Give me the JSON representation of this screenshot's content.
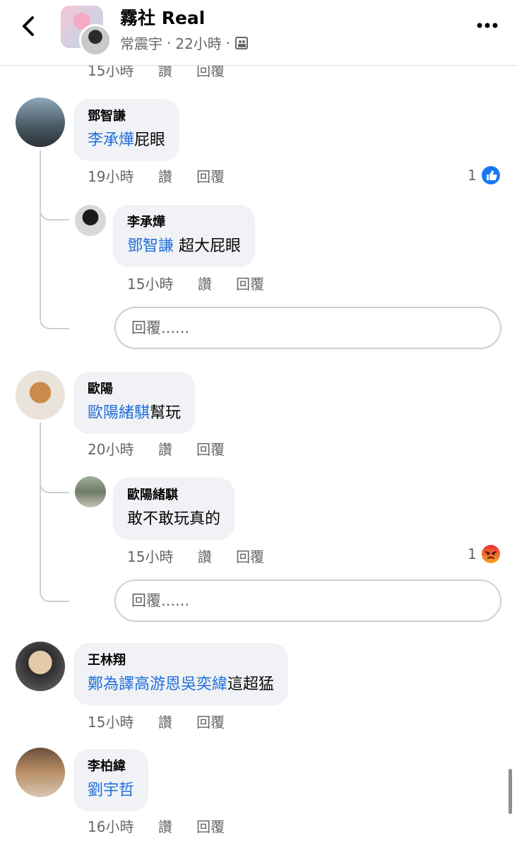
{
  "header": {
    "title": "霧社 Real",
    "poster": "常震宇",
    "sep1": "·",
    "time": "22小時",
    "sep2": "·"
  },
  "top_actions": {
    "time": "15小時",
    "like": "讚",
    "reply": "回覆"
  },
  "comments": [
    {
      "author": "鄧智謙",
      "mention": "李承燁",
      "text": "屁眼",
      "time": "19小時",
      "like": "讚",
      "reply": "回覆",
      "reaction_count": "1",
      "replies": [
        {
          "author": "李承燁",
          "mention": "鄧智謙",
          "text": " 超大屁眼",
          "time": "15小時",
          "like": "讚",
          "reply": "回覆"
        }
      ],
      "reply_placeholder": "回覆......"
    },
    {
      "author": "歐陽",
      "mention": "歐陽緒騏",
      "text": "幫玩",
      "time": "20小時",
      "like": "讚",
      "reply": "回覆",
      "replies": [
        {
          "author": "歐陽緒騏",
          "text": "敢不敢玩真的",
          "time": "15小時",
          "like": "讚",
          "reply": "回覆",
          "reaction_count": "1"
        }
      ],
      "reply_placeholder": "回覆......"
    },
    {
      "author": "王林翔",
      "mention": "鄭為譯高游恩吳奕緯",
      "text": "這超猛",
      "time": "15小時",
      "like": "讚",
      "reply": "回覆"
    },
    {
      "author": "李柏緯",
      "mention": "劉宇哲",
      "time": "16小時",
      "like": "讚",
      "reply": "回覆"
    }
  ],
  "colors": {
    "mention": "#216fdb",
    "like": "#1877f2",
    "angry": "#e9710f",
    "bubble": "#f0f2f5"
  },
  "icons": {
    "back": "chevron-left-icon",
    "more": "more-icon",
    "audience": "group-audience-icon",
    "like": "like-reaction-icon",
    "angry": "angry-reaction-icon"
  }
}
